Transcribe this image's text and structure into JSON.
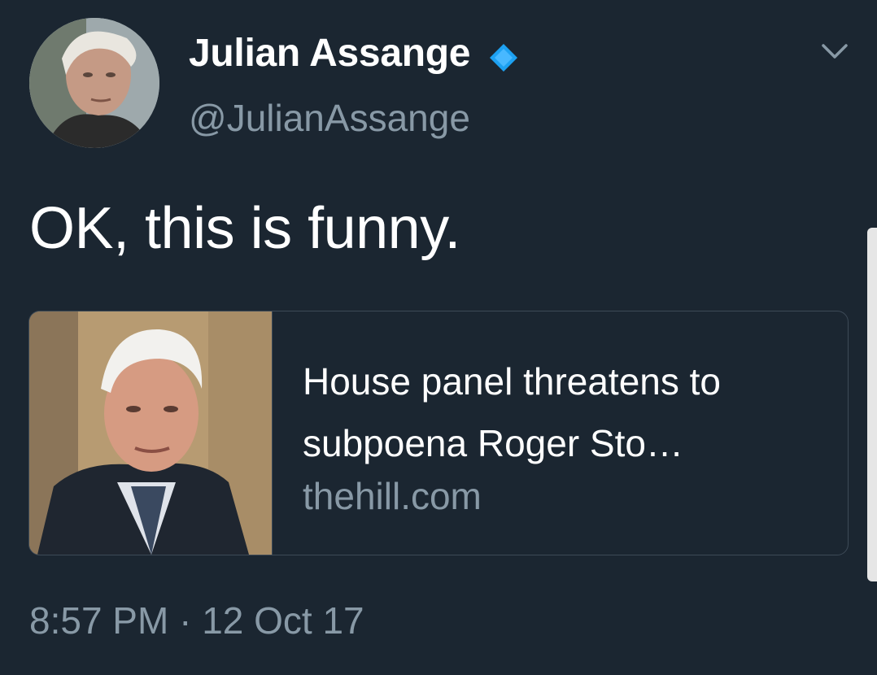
{
  "tweet": {
    "author": {
      "display_name": "Julian Assange",
      "handle": "@JulianAssange",
      "verified": true,
      "verified_color": "#1da1f2"
    },
    "text": "OK, this is funny.",
    "timestamp": "8:57 PM · 12 Oct 17",
    "menu_icon": "chevron-down-icon"
  },
  "card": {
    "title": "House panel threatens to subpoena Roger Sto…",
    "domain": "thehill.com"
  },
  "colors": {
    "background": "#1b2631",
    "primary_text": "#ffffff",
    "secondary_text": "#8899a6",
    "border": "#3d4a57"
  }
}
